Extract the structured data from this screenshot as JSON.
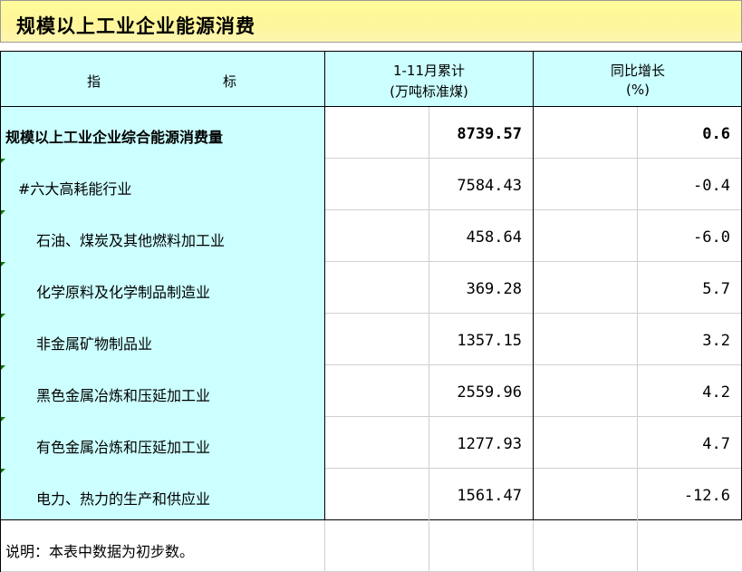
{
  "title": "规模以上工业企业能源消费",
  "header": {
    "col1_a": "指",
    "col1_b": "标",
    "col2_line1": "1-11月累计",
    "col2_line2": "(万吨标准煤)",
    "col3_line1": "同比增长",
    "col3_line2": "(%)"
  },
  "rows": [
    {
      "label": "规模以上工业企业综合能源消费量",
      "value": "8739.57",
      "growth": "0.6"
    },
    {
      "label": "#六大高耗能行业",
      "value": "7584.43",
      "growth": "-0.4"
    },
    {
      "label": "石油、煤炭及其他燃料加工业",
      "value": "458.64",
      "growth": "-6.0"
    },
    {
      "label": "化学原料及化学制品制造业",
      "value": "369.28",
      "growth": "5.7"
    },
    {
      "label": "非金属矿物制品业",
      "value": "1357.15",
      "growth": "3.2"
    },
    {
      "label": "黑色金属冶炼和压延加工业",
      "value": "2559.96",
      "growth": "4.2"
    },
    {
      "label": "有色金属冶炼和压延加工业",
      "value": "1277.93",
      "growth": "4.7"
    },
    {
      "label": "电力、热力的生产和供应业",
      "value": "1561.47",
      "growth": "-12.6"
    }
  ],
  "note": "说明：本表中数据为初步数。",
  "colors": {
    "title_bg": "#fff69a",
    "cyan": "#ccffff",
    "indicator": "#0a7a00"
  }
}
